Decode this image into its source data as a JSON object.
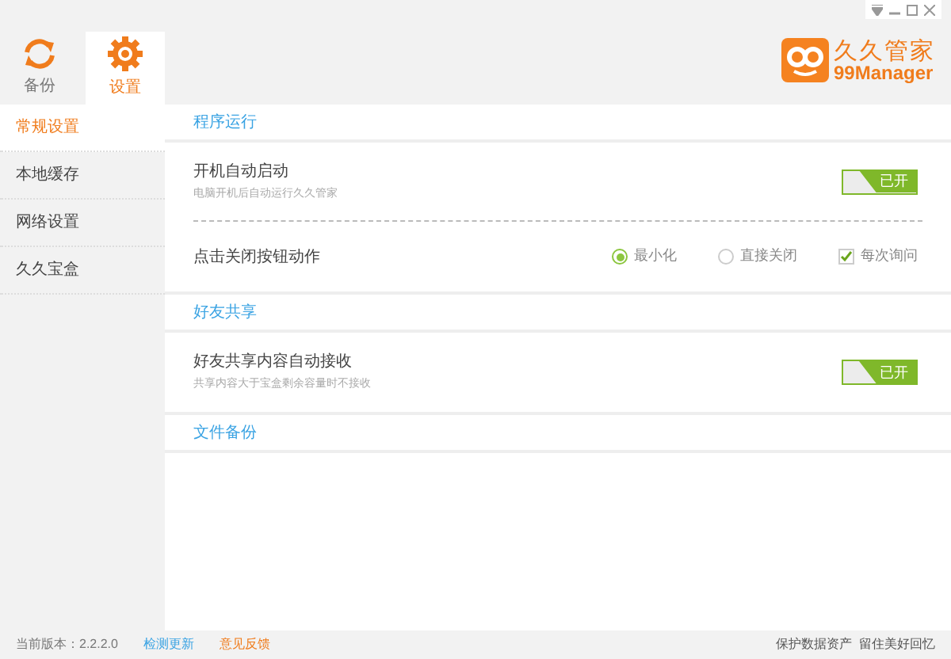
{
  "top_tabs": [
    {
      "label": "备份",
      "kind": "sync",
      "selected": false
    },
    {
      "label": "设置",
      "kind": "gear",
      "selected": true
    }
  ],
  "logo": {
    "name": "久久管家",
    "subtitle": "99Manager"
  },
  "sidebar": {
    "items": [
      {
        "label": "常规设置",
        "selected": true
      },
      {
        "label": "本地缓存",
        "selected": false
      },
      {
        "label": "网络设置",
        "selected": false
      },
      {
        "label": "久久宝盒",
        "selected": false
      }
    ]
  },
  "sections": [
    {
      "title": "程序运行",
      "items": [
        {
          "kind": "toggle",
          "label": "开机自动启动",
          "description": "电脑开机后自动运行久久管家",
          "on": true,
          "state_label": "已开"
        },
        {
          "kind": "choices",
          "label": "点击关闭按钮动作",
          "options": [
            {
              "kind": "radio",
              "label": "最小化",
              "selected": true
            },
            {
              "kind": "radio",
              "label": "直接关闭",
              "selected": false
            },
            {
              "kind": "checkbox",
              "label": "每次询问",
              "checked": true
            }
          ]
        }
      ]
    },
    {
      "title": "好友共享",
      "items": [
        {
          "kind": "toggle",
          "label": "好友共享内容自动接收",
          "description": "共享内容大于宝盒剩余容量时不接收",
          "on": true,
          "state_label": "已开"
        }
      ]
    },
    {
      "title": "文件备份"
    }
  ],
  "status_bar": {
    "version": "当前版本：2.2.2.0",
    "check_update": "检测更新",
    "feedback": "意见反馈",
    "slogan": "保护数据资产  留住美好回忆"
  }
}
